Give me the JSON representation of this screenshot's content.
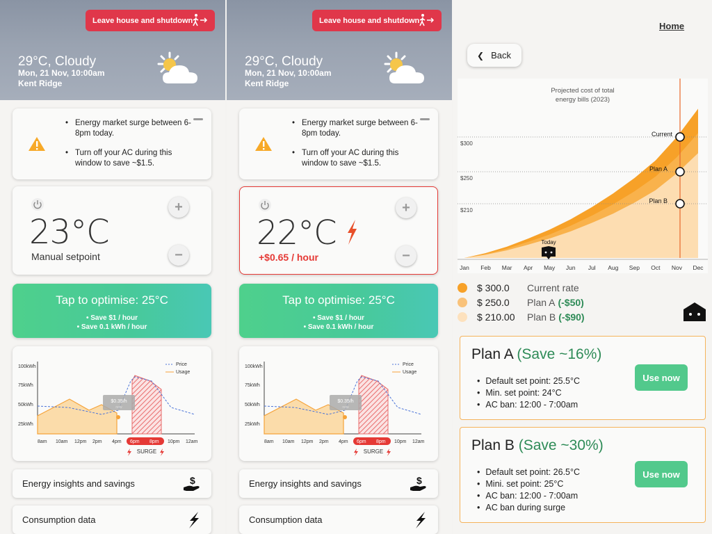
{
  "header": {
    "leave_label": "Leave house and shutdown",
    "weather": "29°C, Cloudy",
    "datetime": "Mon, 21 Nov, 10:00am",
    "location": "Kent Ridge"
  },
  "alert": {
    "line1": "Energy market surge between 6-8pm today.",
    "line2": "Turn off your AC during this window to save ~$1.5."
  },
  "screen1": {
    "setpoint": "23°C",
    "setpoint_label": "Manual setpoint"
  },
  "screen2": {
    "setpoint": "22°C",
    "cost_label": "+$0.65 / hour"
  },
  "optimise": {
    "title": "Tap to optimise: 25°C",
    "line1": "• Save $1 / hour",
    "line2": "• Save 0.1 kWh / hour"
  },
  "usage_chart": {
    "type": "line",
    "y_ticks": [
      "100kWh",
      "75kWh",
      "50kWh",
      "25kWh"
    ],
    "x_ticks": [
      "8am",
      "10am",
      "12pm",
      "2pm",
      "4pm",
      "6pm",
      "8pm",
      "10pm",
      "12am"
    ],
    "legend": [
      "Price",
      "Usage"
    ],
    "tooltip_value": "$0.35/h",
    "tooltip_sub": "now",
    "surge_label": "SURGE",
    "colors": {
      "price": "#4a73d8",
      "usage": "#f5a33a",
      "surge": "#e53935"
    }
  },
  "links": {
    "insights": "Energy insights and savings",
    "consumption": "Consumption data"
  },
  "screen3": {
    "home_label": "Home",
    "back_label": "Back",
    "chart_title_1": "Projected cost of total",
    "chart_title_2": "energy bills (2023)",
    "y_labels": [
      "$300",
      "$250",
      "$210"
    ],
    "months": [
      "Jan",
      "Feb",
      "Mar",
      "Apr",
      "May",
      "Jun",
      "Jul",
      "Aug",
      "Sep",
      "Oct",
      "Nov",
      "Dec"
    ],
    "today_label": "Today",
    "marker_current": "Current",
    "marker_a": "Plan A",
    "marker_b": "Plan B",
    "legend": [
      {
        "amount": "$ 300.0",
        "name": "Current rate",
        "save": "",
        "color": "#f7a128"
      },
      {
        "amount": "$ 250.0",
        "name": "Plan A",
        "save": "(-$50)",
        "color": "#f9c27a"
      },
      {
        "amount": "$ 210.00",
        "name": "Plan B",
        "save": "(-$90)",
        "color": "#fde1bd"
      }
    ],
    "plan_a": {
      "name": "Plan A",
      "save": "(Save ~16%)",
      "items": [
        "Default set point: 25.5°C",
        "Min. set point: 24°C",
        "AC ban: 12:00 - 7:00am"
      ],
      "button": "Use now"
    },
    "plan_b": {
      "name": "Plan B",
      "save": "(Save ~30%)",
      "items": [
        "Default set point: 26.5°C",
        "Mini. set point: 25°C",
        "AC ban: 12:00 - 7:00am",
        "AC ban during surge"
      ],
      "button": "Use now"
    }
  },
  "chart_data": {
    "type": "area",
    "title": "Projected cost of total energy bills (2023)",
    "categories": [
      "Jan",
      "Feb",
      "Mar",
      "Apr",
      "May",
      "Jun",
      "Jul",
      "Aug",
      "Sep",
      "Oct",
      "Nov",
      "Dec"
    ],
    "series": [
      {
        "name": "Current rate",
        "values": [
          0,
          12,
          28,
          48,
          70,
          96,
          126,
          160,
          198,
          242,
          300,
          370
        ]
      },
      {
        "name": "Plan A",
        "values": [
          0,
          10,
          23,
          40,
          58,
          80,
          105,
          133,
          165,
          202,
          250,
          310
        ]
      },
      {
        "name": "Plan B",
        "values": [
          0,
          8,
          19,
          33,
          48,
          66,
          87,
          110,
          137,
          168,
          210,
          260
        ]
      }
    ],
    "y_ticks": [
      210,
      250,
      300
    ],
    "today": "May"
  }
}
